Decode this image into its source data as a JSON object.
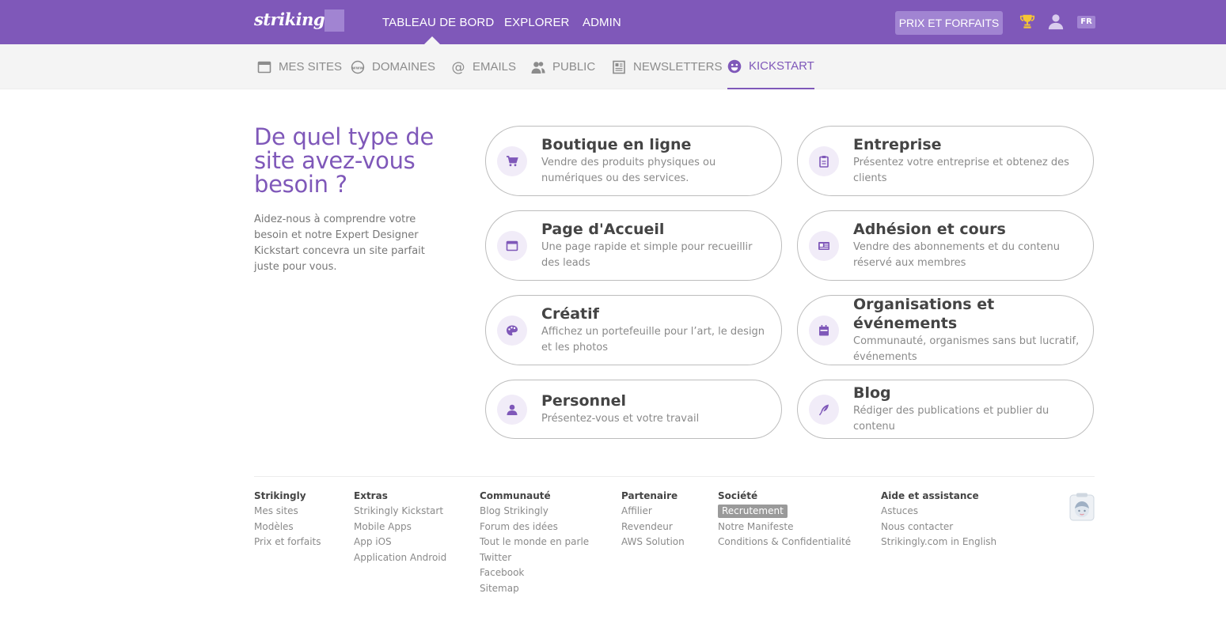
{
  "header": {
    "logo_text": "strikingly",
    "nav": [
      {
        "label": "TABLEAU DE BORD"
      },
      {
        "label": "EXPLORER"
      },
      {
        "label": "ADMIN"
      }
    ],
    "pricing_label": "PRIX ET FORFAITS",
    "lang_label": "FR",
    "brand_color": "#7f58b9"
  },
  "subnav": {
    "items": [
      {
        "label": "MES SITES",
        "icon": "browser-window-icon"
      },
      {
        "label": "DOMAINES",
        "icon": "www-globe-icon"
      },
      {
        "label": "EMAILS",
        "icon": "at-sign-icon"
      },
      {
        "label": "PUBLIC",
        "icon": "users-icon"
      },
      {
        "label": "NEWSLETTERS",
        "icon": "newspaper-icon"
      },
      {
        "label": "KICKSTART",
        "icon": "smiley-icon",
        "active": true
      }
    ]
  },
  "intro": {
    "title": "De quel type de site avez-vous besoin ?",
    "text": "Aidez-nous à comprendre votre besoin et notre Expert Designer Kickstart concevra un site parfait juste pour vous."
  },
  "cards": [
    {
      "title": "Boutique en ligne",
      "desc": "Vendre des produits physiques ou numériques ou des services.",
      "icon": "shopping-cart-icon"
    },
    {
      "title": "Entreprise",
      "desc": "Présentez votre entreprise et obtenez des clients",
      "icon": "clipboard-icon"
    },
    {
      "title": "Page d'Accueil",
      "desc": "Une page rapide et simple pour recueillir des leads",
      "icon": "browser-window-icon"
    },
    {
      "title": "Adhésion et cours",
      "desc": "Vendre des abonnements et du contenu réservé aux membres",
      "icon": "id-card-icon"
    },
    {
      "title": "Créatif",
      "desc": "Affichez un portefeuille pour l’art, le design et les photos",
      "icon": "palette-icon"
    },
    {
      "title": "Organisations et événements",
      "desc": "Communauté, organismes sans but lucratif, événements",
      "icon": "calendar-icon"
    },
    {
      "title": "Personnel",
      "desc": "Présentez-vous et votre travail",
      "icon": "person-icon"
    },
    {
      "title": "Blog",
      "desc": "Rédiger des publications et publier du contenu",
      "icon": "quill-icon"
    }
  ],
  "footer": {
    "columns": [
      {
        "heading": "Strikingly",
        "links": [
          "Mes sites",
          "Modèles",
          "Prix et forfaits"
        ]
      },
      {
        "heading": "Extras",
        "links": [
          "Strikingly Kickstart",
          "Mobile Apps",
          "App iOS",
          "Application Android"
        ]
      },
      {
        "heading": "Communauté",
        "links": [
          "Blog Strikingly",
          "Forum des idées",
          "Tout le monde en parle",
          "Twitter",
          "Facebook",
          "Sitemap"
        ]
      },
      {
        "heading": "Partenaire",
        "links": [
          "Affilier",
          "Revendeur",
          "AWS Solution"
        ]
      },
      {
        "heading": "Société",
        "links": [
          "Recrutement",
          "Notre Manifeste",
          "Conditions & Confidentialité"
        ]
      },
      {
        "heading": "Aide et assistance",
        "links": [
          "Astuces",
          "Nous contacter",
          "Strikingly.com in English"
        ]
      }
    ]
  }
}
